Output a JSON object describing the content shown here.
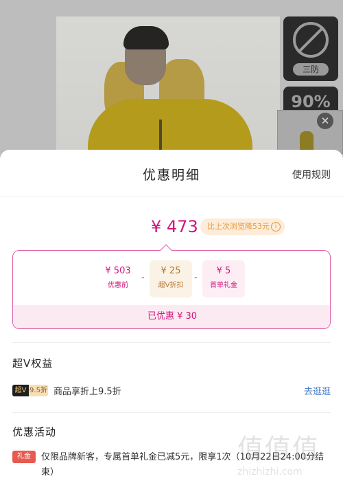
{
  "product_page": {
    "badge_anti_label": "三防",
    "badge_percent": "90%",
    "close_symbol": "✕"
  },
  "sheet": {
    "title": "优惠明细",
    "rules_link": "使用规则",
    "final_price": "¥ 473",
    "compare_text": "比上次浏览降53元",
    "info_symbol": "i"
  },
  "breakdown": {
    "before": {
      "amount": "¥ 503",
      "label": "优惠前"
    },
    "op_minus": "-",
    "vip_discount": {
      "amount": "¥ 25",
      "label": "超V折扣"
    },
    "first_order_gift": {
      "amount": "¥ 5",
      "label": "首单礼金"
    },
    "saved_text": "已优惠 ¥ 30"
  },
  "vip_section": {
    "title": "超V权益",
    "tag_left": "超V",
    "tag_right": "9.5折",
    "text": "商品享折上9.5折",
    "link": "去逛逛"
  },
  "promo_section": {
    "title": "优惠活动",
    "tag": "礼金",
    "text": "仅限品牌新客，专属首单礼金已减5元，限享1次（10月22日24:00分结束）"
  },
  "watermark": {
    "glyphs": "值值值",
    "url": "zhizhizhi.com"
  },
  "colors": {
    "accent_pink": "#d0157a",
    "accent_orange": "#e39a3a",
    "link_blue": "#4a7fc9",
    "promo_red": "#e85a4f"
  }
}
